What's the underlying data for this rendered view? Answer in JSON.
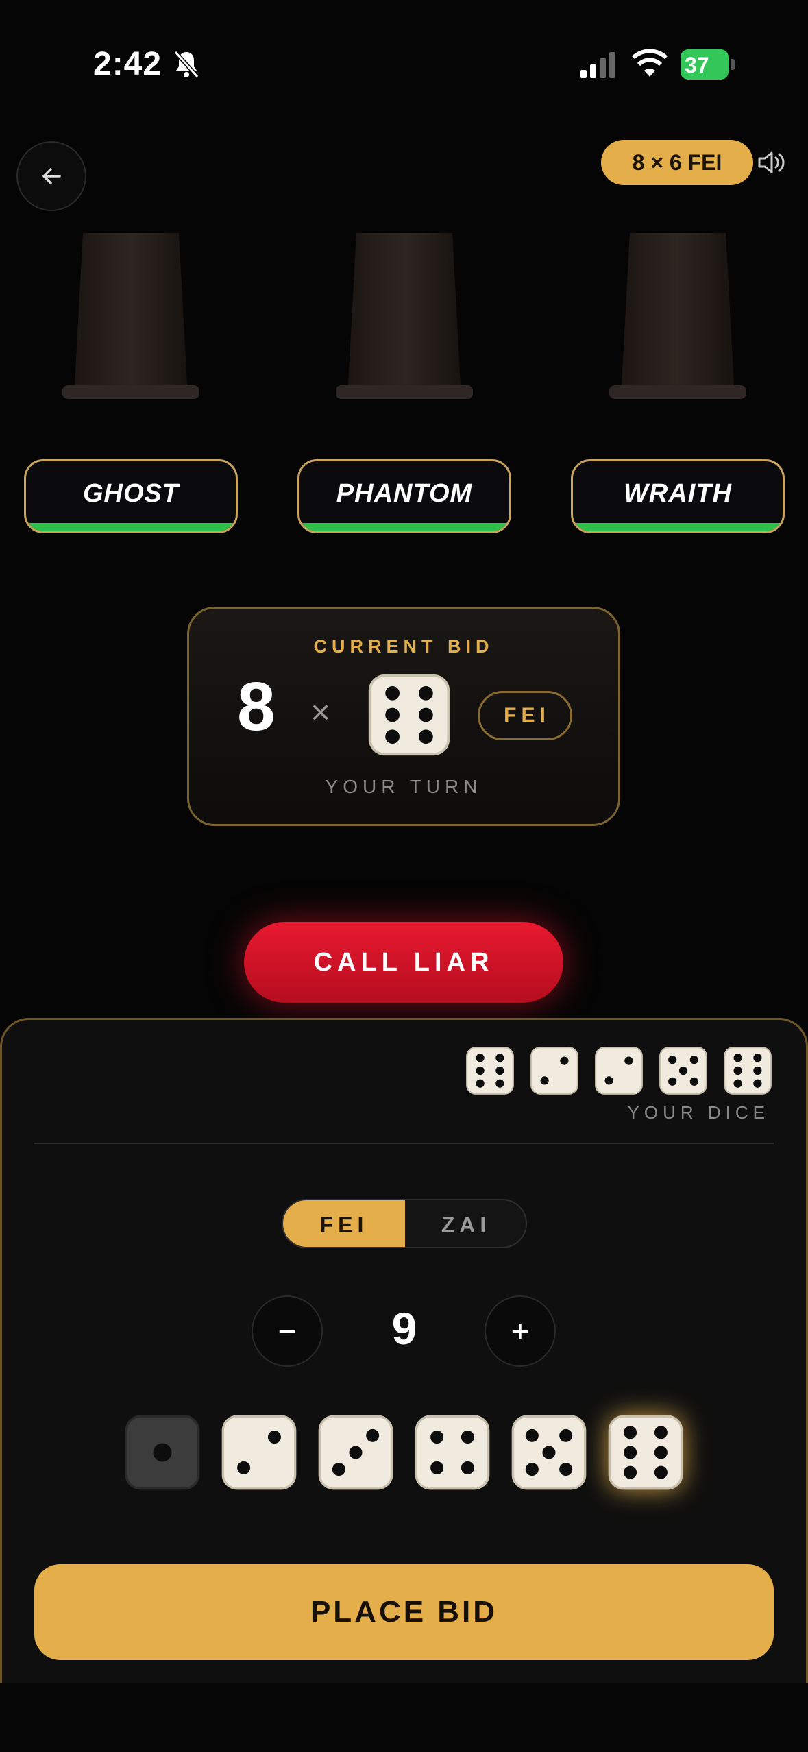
{
  "status_bar": {
    "time": "2:42",
    "battery": "37"
  },
  "header": {
    "bid_badge": "8 × 6 FEI"
  },
  "players": [
    {
      "name": "GHOST",
      "health": 1.0
    },
    {
      "name": "PHANTOM",
      "health": 1.0
    },
    {
      "name": "WRAITH",
      "health": 1.0
    }
  ],
  "current_bid": {
    "label": "CURRENT BID",
    "quantity": "8",
    "times": "×",
    "face": 6,
    "mode": "FEI",
    "turn_text": "YOUR TURN"
  },
  "actions": {
    "call_liar": "CALL LIAR",
    "place_bid": "PLACE BID"
  },
  "my_dice": {
    "values": [
      6,
      2,
      2,
      5,
      6
    ],
    "label": "YOUR DICE"
  },
  "mode_toggle": {
    "options": [
      "FEI",
      "ZAI"
    ],
    "selected": "FEI"
  },
  "stepper": {
    "minus": "−",
    "value": "9",
    "plus": "+"
  },
  "face_options": {
    "faces": [
      1,
      2,
      3,
      4,
      5,
      6
    ],
    "selected": 6
  },
  "colors": {
    "accent": "#e4ae4a",
    "danger": "#e8192f",
    "health": "#2fbf4a"
  }
}
